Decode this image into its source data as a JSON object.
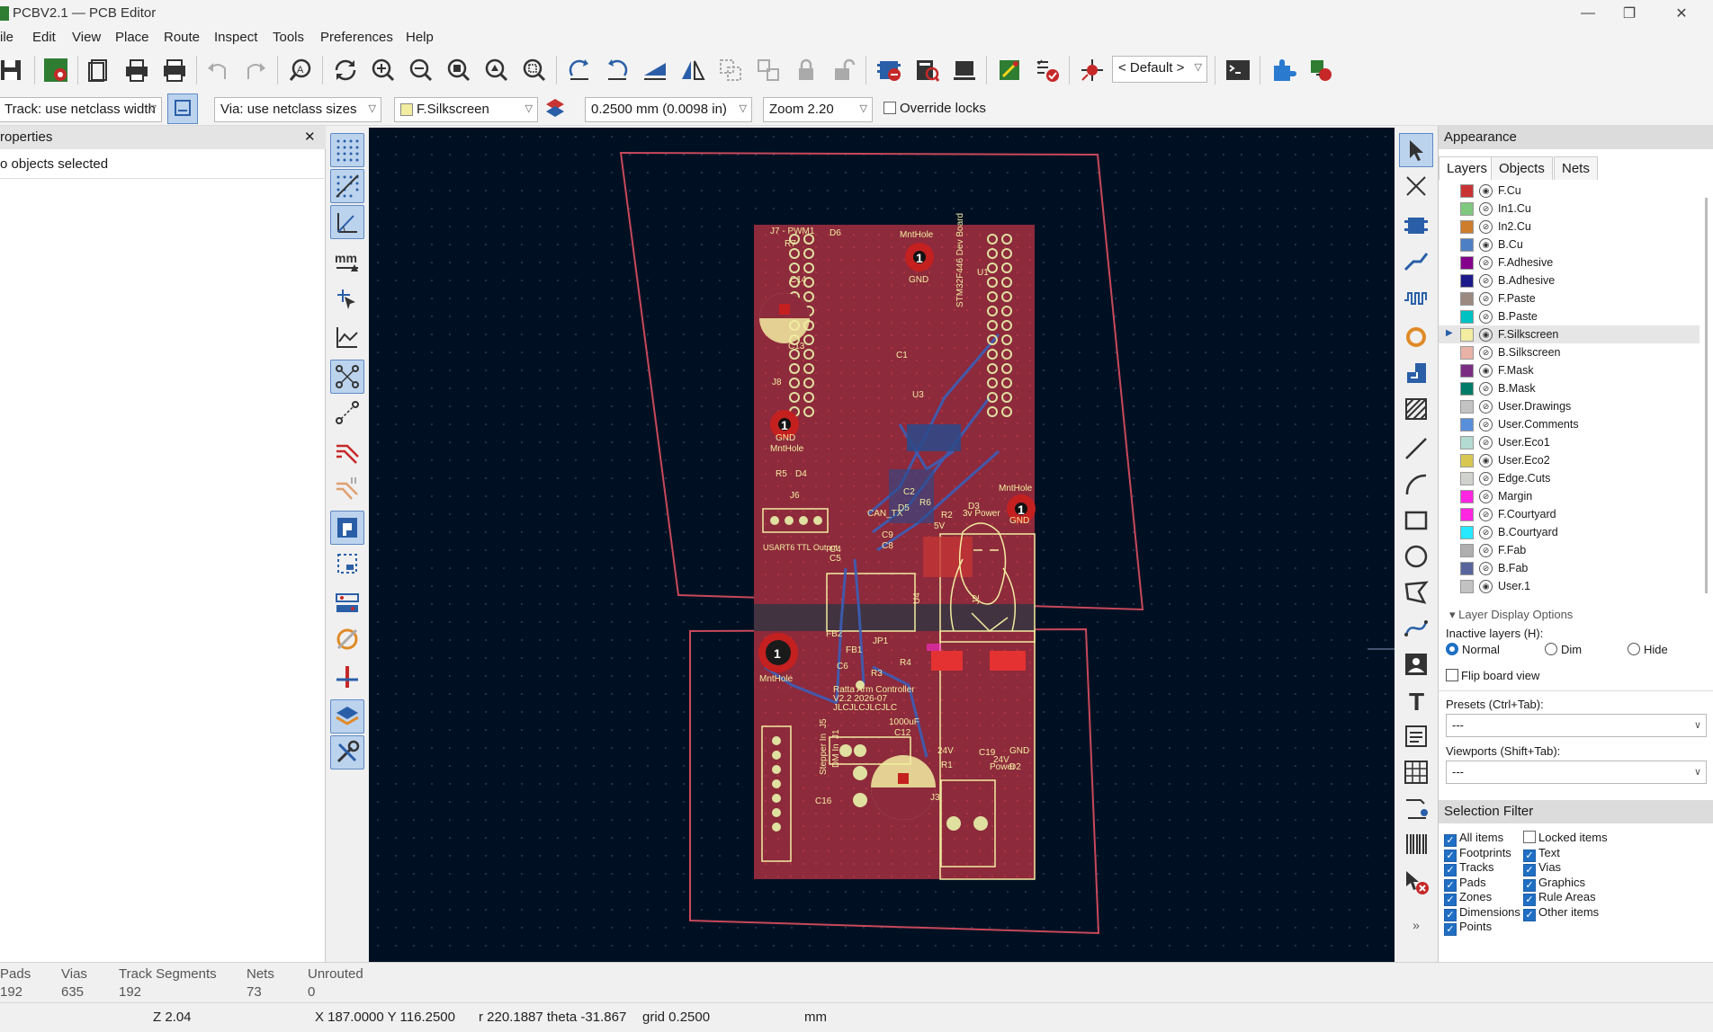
{
  "window": {
    "title": "PCBV2.1 — PCB Editor",
    "minimize": "—",
    "restore": "❐",
    "close": "✕"
  },
  "menu": [
    "ile",
    "Edit",
    "View",
    "Place",
    "Route",
    "Inspect",
    "Tools",
    "Preferences",
    "Help"
  ],
  "toolbar": {
    "viewport_combo": "< Default >"
  },
  "toolbar2": {
    "track": "Track: use netclass width",
    "via": "Via: use netclass sizes",
    "layer": "F.Silkscreen",
    "grid": "0.2500 mm (0.0098 in)",
    "zoom": "Zoom 2.20",
    "override_locks": "Override locks"
  },
  "properties": {
    "title": "roperties",
    "close": "✕",
    "status": "o objects selected"
  },
  "appearance": {
    "title": "Appearance",
    "tabs": [
      "Layers",
      "Objects",
      "Nets"
    ],
    "layers": [
      {
        "name": "F.Cu",
        "color": "#c83434",
        "visible": true
      },
      {
        "name": "In1.Cu",
        "color": "#7fc87f",
        "visible": false
      },
      {
        "name": "In2.Cu",
        "color": "#ce7d2c",
        "visible": false
      },
      {
        "name": "B.Cu",
        "color": "#4d7fc4",
        "visible": true
      },
      {
        "name": "F.Adhesive",
        "color": "#84008a",
        "visible": false
      },
      {
        "name": "B.Adhesive",
        "color": "#1d1b8a",
        "visible": false
      },
      {
        "name": "F.Paste",
        "color": "#9a8a80",
        "visible": false
      },
      {
        "name": "B.Paste",
        "color": "#00c2c2",
        "visible": false
      },
      {
        "name": "F.Silkscreen",
        "color": "#f2eda1",
        "visible": true,
        "selected": true
      },
      {
        "name": "B.Silkscreen",
        "color": "#e8b2a7",
        "visible": false
      },
      {
        "name": "F.Mask",
        "color": "#7a2e83",
        "visible": true
      },
      {
        "name": "B.Mask",
        "color": "#027c68",
        "visible": false
      },
      {
        "name": "User.Drawings",
        "color": "#c2c2c2",
        "visible": false
      },
      {
        "name": "User.Comments",
        "color": "#598ed8",
        "visible": false
      },
      {
        "name": "User.Eco1",
        "color": "#b4dbd2",
        "visible": false
      },
      {
        "name": "User.Eco2",
        "color": "#d8c852",
        "visible": true
      },
      {
        "name": "Edge.Cuts",
        "color": "#d0d2cd",
        "visible": false
      },
      {
        "name": "Margin",
        "color": "#ff26e2",
        "visible": false
      },
      {
        "name": "F.Courtyard",
        "color": "#ff26e2",
        "visible": false
      },
      {
        "name": "B.Courtyard",
        "color": "#26e9ff",
        "visible": false
      },
      {
        "name": "F.Fab",
        "color": "#afafaf",
        "visible": false
      },
      {
        "name": "B.Fab",
        "color": "#58659b",
        "visible": false
      },
      {
        "name": "User.1",
        "color": "#c2c2c2",
        "visible": true
      }
    ],
    "layer_display_options": "Layer Display Options",
    "inactive_layers": "Inactive layers (H):",
    "inactive_opts": [
      "Normal",
      "Dim",
      "Hide"
    ],
    "flip_board": "Flip board view",
    "presets_label": "Presets (Ctrl+Tab):",
    "presets_value": "---",
    "viewports_label": "Viewports (Shift+Tab):",
    "viewports_value": "---"
  },
  "selection_filter": {
    "title": "Selection Filter",
    "items": [
      {
        "label": "All items",
        "checked": true
      },
      {
        "label": "Locked items",
        "checked": false
      },
      {
        "label": "Footprints",
        "checked": true
      },
      {
        "label": "Text",
        "checked": true
      },
      {
        "label": "Tracks",
        "checked": true
      },
      {
        "label": "Vias",
        "checked": true
      },
      {
        "label": "Pads",
        "checked": true
      },
      {
        "label": "Graphics",
        "checked": true
      },
      {
        "label": "Zones",
        "checked": true
      },
      {
        "label": "Rule Areas",
        "checked": true
      },
      {
        "label": "Dimensions",
        "checked": true
      },
      {
        "label": "Other items",
        "checked": true
      },
      {
        "label": "Points",
        "checked": true
      }
    ]
  },
  "status": {
    "pads_label": "Pads",
    "pads": "192",
    "vias_label": "Vias",
    "vias": "635",
    "tracks_label": "Track Segments",
    "tracks": "192",
    "nets_label": "Nets",
    "nets": "73",
    "unrouted_label": "Unrouted",
    "unrouted": "0",
    "zoom": "Z 2.04",
    "xy": "X 187.0000  Y 116.2500",
    "polar": "r 220.1887  theta -31.867",
    "grid": "grid 0.2500",
    "units": "mm"
  },
  "board": {
    "labels": [
      "J7 - PWM1",
      "R7",
      "D6",
      "C14",
      "C13",
      "J8",
      "MntHole",
      "GND",
      "MntHole",
      "GND",
      "STM32F446 Dev Board",
      "U1",
      "C1",
      "U3",
      "R5",
      "D4",
      "J6",
      "C2",
      "CAN_TX",
      "D5",
      "R6",
      "R2",
      "D3",
      "3v Power",
      "5V",
      "MntHole",
      "GND",
      "C9",
      "C8",
      "C4",
      "C5",
      "USART6 TTL Output",
      "U4",
      "J2",
      "FB2",
      "FB1",
      "JP1",
      "C6",
      "R3",
      "R4",
      "MntHole",
      "Ratta Arm Controller",
      "V2.2 2026-07",
      "JLCJLCJLCJLC",
      "1000uF",
      "C12",
      "J5",
      "Stepper In",
      "DM In",
      "J1",
      "24V",
      "R1",
      "C19",
      "24V",
      "Power",
      "D2",
      "GND",
      "C16",
      "J3",
      "1",
      "1",
      "1",
      "1"
    ]
  }
}
